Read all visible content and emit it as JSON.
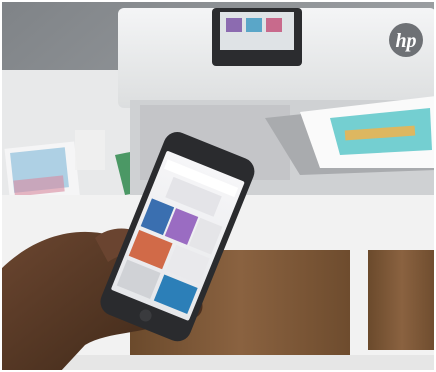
{
  "photo": {
    "subject": "printer-and-smartphone",
    "brand_logo_text": "hp",
    "colors": {
      "wall": "#9a9ea2",
      "printer_body": "#e9eaeb",
      "printer_panel": "#d6d8da",
      "cabinet_wood": "#7a5533",
      "cabinet_white": "#f3f3f3",
      "phone_frame": "#2a2b2e",
      "skin": "#5a3a24"
    }
  }
}
